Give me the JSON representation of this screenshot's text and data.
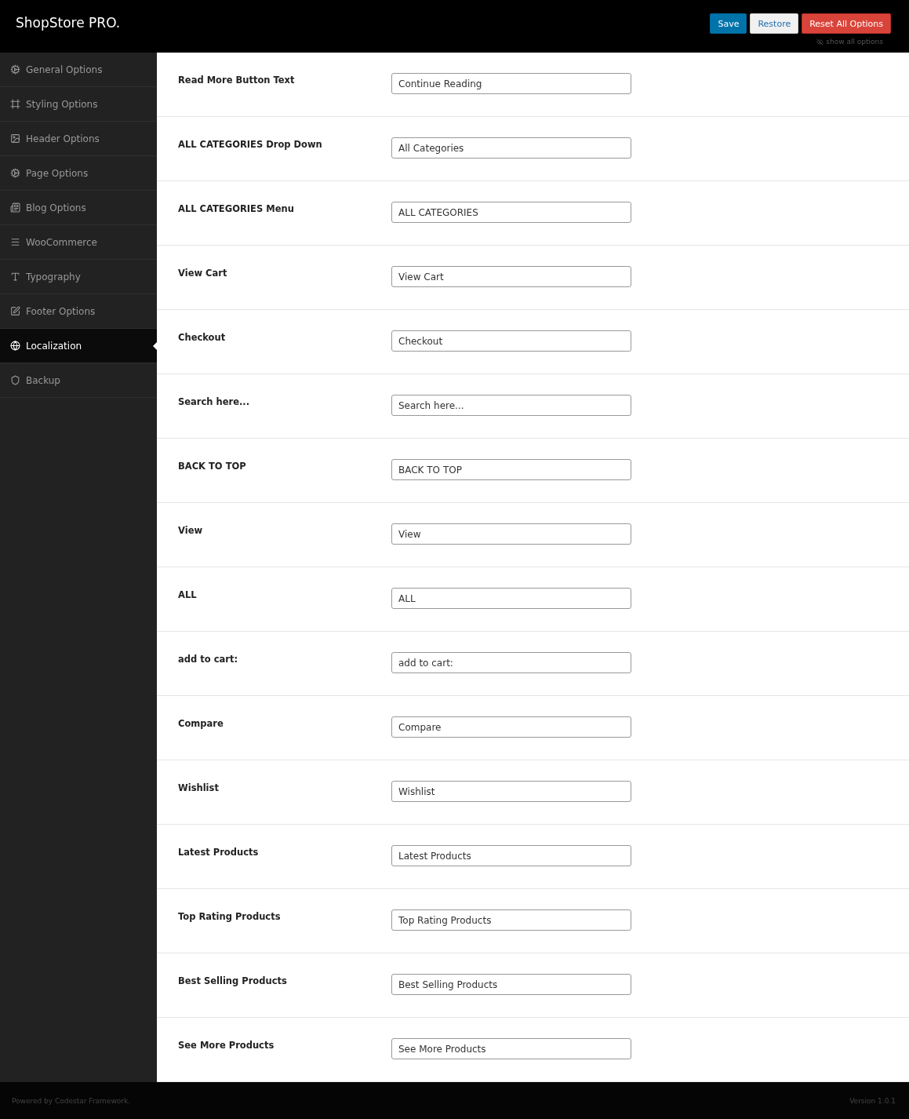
{
  "header": {
    "title": "ShopStore PRO.",
    "buttons": [
      {
        "label": "Save",
        "kind": "save"
      },
      {
        "label": "Restore",
        "kind": "restore"
      },
      {
        "label": "Reset All Options",
        "kind": "reset"
      }
    ],
    "show_all": "show all options"
  },
  "sidebar": {
    "items": [
      {
        "label": "General Options",
        "selected": false
      },
      {
        "label": "Styling Options",
        "selected": false
      },
      {
        "label": "Header Options",
        "selected": false
      },
      {
        "label": "Page Options",
        "selected": false
      },
      {
        "label": "Blog Options",
        "selected": false
      },
      {
        "label": "WooCommerce",
        "selected": false
      },
      {
        "label": "Typography",
        "selected": false
      },
      {
        "label": "Footer Options",
        "selected": false
      },
      {
        "label": "Localization",
        "selected": true
      },
      {
        "label": "Backup",
        "selected": false
      }
    ]
  },
  "fields": [
    {
      "label": "Read More Button Text",
      "value": "Continue Reading"
    },
    {
      "label": "ALL CATEGORIES Drop Down",
      "value": "All Categories"
    },
    {
      "label": "ALL CATEGORIES Menu",
      "value": "ALL CATEGORIES"
    },
    {
      "label": "View Cart",
      "value": "View Cart"
    },
    {
      "label": "Checkout",
      "value": "Checkout"
    },
    {
      "label": "Search here...",
      "value": "Search here..."
    },
    {
      "label": "BACK TO TOP",
      "value": "BACK TO TOP"
    },
    {
      "label": "View",
      "value": "View"
    },
    {
      "label": "ALL",
      "value": "ALL"
    },
    {
      "label": "add to cart:",
      "value": "add to cart:"
    },
    {
      "label": "Compare",
      "value": "Compare"
    },
    {
      "label": "Wishlist",
      "value": "Wishlist"
    },
    {
      "label": "Latest Products",
      "value": "Latest Products"
    },
    {
      "label": "Top Rating Products",
      "value": "Top Rating Products"
    },
    {
      "label": "Best Selling Products",
      "value": "Best Selling Products"
    },
    {
      "label": "See More Products",
      "value": "See More Products"
    }
  ],
  "footer": {
    "credit": "Powered by Codestar Framework.",
    "version": "Version 1.0.1"
  }
}
